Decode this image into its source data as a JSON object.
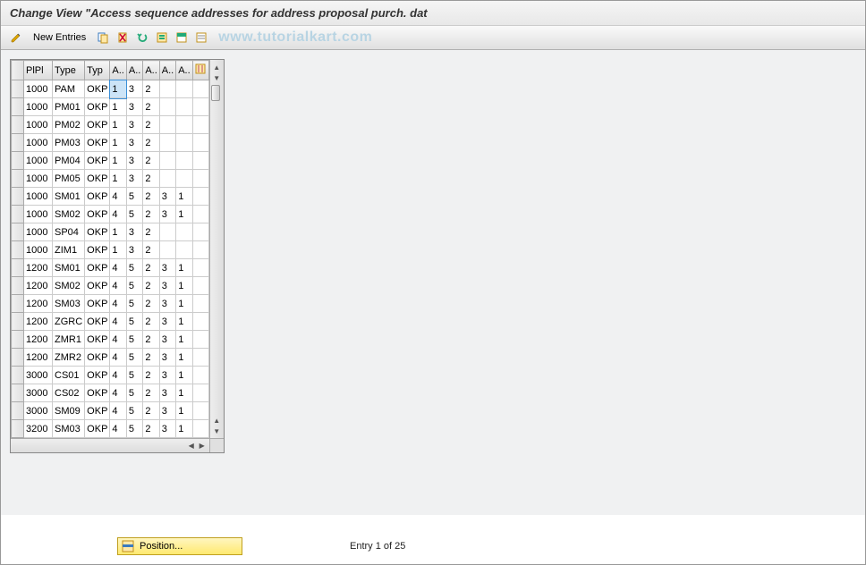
{
  "title": "Change View \"Access sequence addresses for address proposal purch. dat",
  "toolbar": {
    "new_entries": "New Entries"
  },
  "watermark": "www.tutorialkart.com",
  "table": {
    "headers": [
      "PlPl",
      "Type",
      "Typ",
      "A..",
      "A..",
      "A..",
      "A..",
      "A.."
    ],
    "rows": [
      {
        "pipi": "1000",
        "type": "PAM",
        "typ": "OKP",
        "a1": "1",
        "a2": "3",
        "a3": "2",
        "a4": "",
        "a5": "",
        "sel": true
      },
      {
        "pipi": "1000",
        "type": "PM01",
        "typ": "OKP",
        "a1": "1",
        "a2": "3",
        "a3": "2",
        "a4": "",
        "a5": ""
      },
      {
        "pipi": "1000",
        "type": "PM02",
        "typ": "OKP",
        "a1": "1",
        "a2": "3",
        "a3": "2",
        "a4": "",
        "a5": ""
      },
      {
        "pipi": "1000",
        "type": "PM03",
        "typ": "OKP",
        "a1": "1",
        "a2": "3",
        "a3": "2",
        "a4": "",
        "a5": ""
      },
      {
        "pipi": "1000",
        "type": "PM04",
        "typ": "OKP",
        "a1": "1",
        "a2": "3",
        "a3": "2",
        "a4": "",
        "a5": ""
      },
      {
        "pipi": "1000",
        "type": "PM05",
        "typ": "OKP",
        "a1": "1",
        "a2": "3",
        "a3": "2",
        "a4": "",
        "a5": ""
      },
      {
        "pipi": "1000",
        "type": "SM01",
        "typ": "OKP",
        "a1": "4",
        "a2": "5",
        "a3": "2",
        "a4": "3",
        "a5": "1"
      },
      {
        "pipi": "1000",
        "type": "SM02",
        "typ": "OKP",
        "a1": "4",
        "a2": "5",
        "a3": "2",
        "a4": "3",
        "a5": "1"
      },
      {
        "pipi": "1000",
        "type": "SP04",
        "typ": "OKP",
        "a1": "1",
        "a2": "3",
        "a3": "2",
        "a4": "",
        "a5": ""
      },
      {
        "pipi": "1000",
        "type": "ZIM1",
        "typ": "OKP",
        "a1": "1",
        "a2": "3",
        "a3": "2",
        "a4": "",
        "a5": ""
      },
      {
        "pipi": "1200",
        "type": "SM01",
        "typ": "OKP",
        "a1": "4",
        "a2": "5",
        "a3": "2",
        "a4": "3",
        "a5": "1"
      },
      {
        "pipi": "1200",
        "type": "SM02",
        "typ": "OKP",
        "a1": "4",
        "a2": "5",
        "a3": "2",
        "a4": "3",
        "a5": "1"
      },
      {
        "pipi": "1200",
        "type": "SM03",
        "typ": "OKP",
        "a1": "4",
        "a2": "5",
        "a3": "2",
        "a4": "3",
        "a5": "1"
      },
      {
        "pipi": "1200",
        "type": "ZGRC",
        "typ": "OKP",
        "a1": "4",
        "a2": "5",
        "a3": "2",
        "a4": "3",
        "a5": "1"
      },
      {
        "pipi": "1200",
        "type": "ZMR1",
        "typ": "OKP",
        "a1": "4",
        "a2": "5",
        "a3": "2",
        "a4": "3",
        "a5": "1"
      },
      {
        "pipi": "1200",
        "type": "ZMR2",
        "typ": "OKP",
        "a1": "4",
        "a2": "5",
        "a3": "2",
        "a4": "3",
        "a5": "1"
      },
      {
        "pipi": "3000",
        "type": "CS01",
        "typ": "OKP",
        "a1": "4",
        "a2": "5",
        "a3": "2",
        "a4": "3",
        "a5": "1"
      },
      {
        "pipi": "3000",
        "type": "CS02",
        "typ": "OKP",
        "a1": "4",
        "a2": "5",
        "a3": "2",
        "a4": "3",
        "a5": "1"
      },
      {
        "pipi": "3000",
        "type": "SM09",
        "typ": "OKP",
        "a1": "4",
        "a2": "5",
        "a3": "2",
        "a4": "3",
        "a5": "1"
      },
      {
        "pipi": "3200",
        "type": "SM03",
        "typ": "OKP",
        "a1": "4",
        "a2": "5",
        "a3": "2",
        "a4": "3",
        "a5": "1"
      }
    ]
  },
  "footer": {
    "position_label": "Position...",
    "entry_text": "Entry 1 of 25"
  }
}
